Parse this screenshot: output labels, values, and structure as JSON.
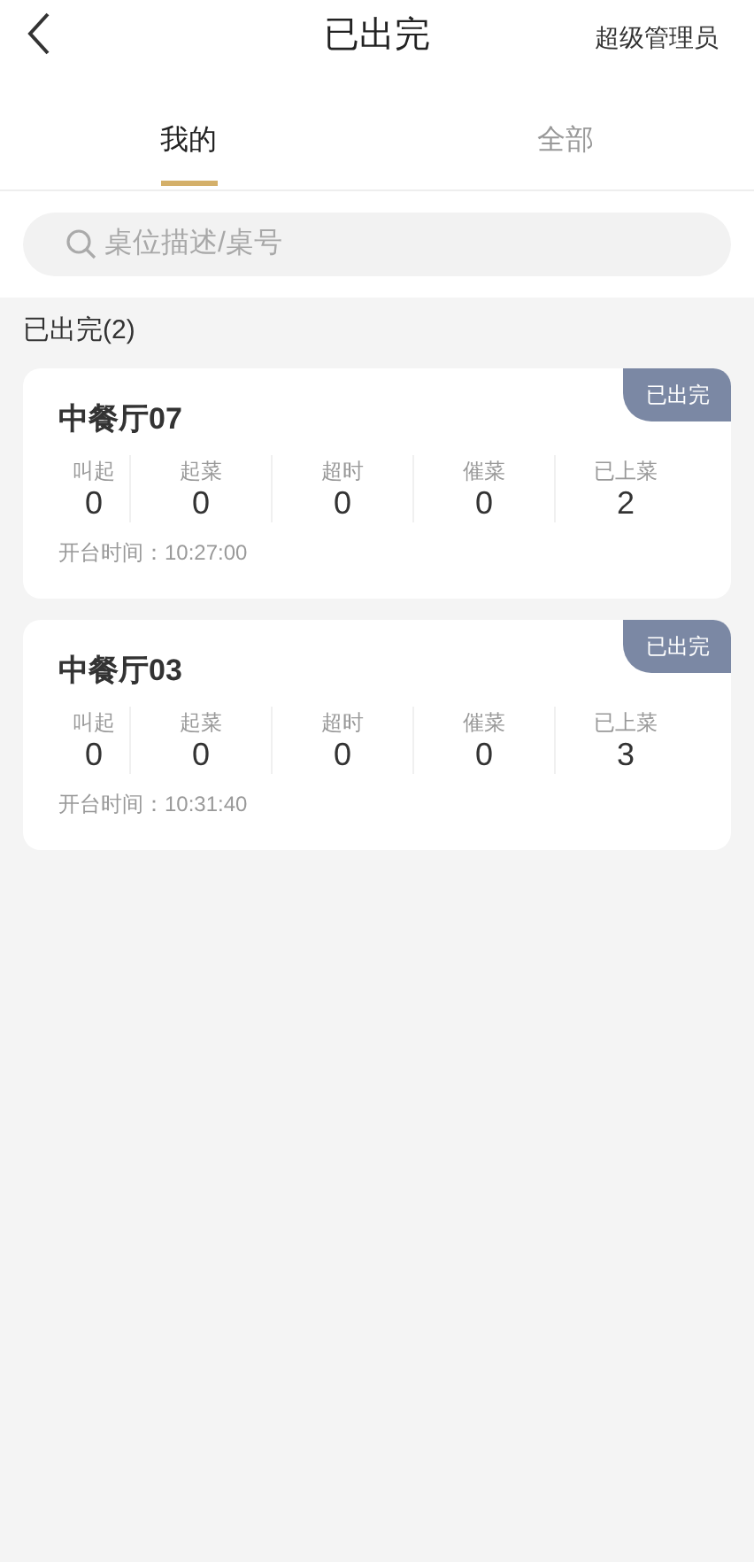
{
  "header": {
    "title": "已出完",
    "user": "超级管理员"
  },
  "tabs": [
    {
      "label": "我的",
      "selected": true
    },
    {
      "label": "全部",
      "selected": false
    }
  ],
  "search": {
    "placeholder": "桌位描述/桌号"
  },
  "section": {
    "title": "已出完(2)"
  },
  "tables": [
    {
      "name": "中餐厅07",
      "status": "已出完",
      "stats": [
        {
          "label": "叫起",
          "value": "0"
        },
        {
          "label": "起菜",
          "value": "0"
        },
        {
          "label": "超时",
          "value": "0"
        },
        {
          "label": "催菜",
          "value": "0"
        },
        {
          "label": "已上菜",
          "value": "2"
        }
      ],
      "open_time": "开台时间：10:27:00"
    },
    {
      "name": "中餐厅03",
      "status": "已出完",
      "stats": [
        {
          "label": "叫起",
          "value": "0"
        },
        {
          "label": "起菜",
          "value": "0"
        },
        {
          "label": "超时",
          "value": "0"
        },
        {
          "label": "催菜",
          "value": "0"
        },
        {
          "label": "已上菜",
          "value": "3"
        }
      ],
      "open_time": "开台时间：10:31:40"
    }
  ]
}
